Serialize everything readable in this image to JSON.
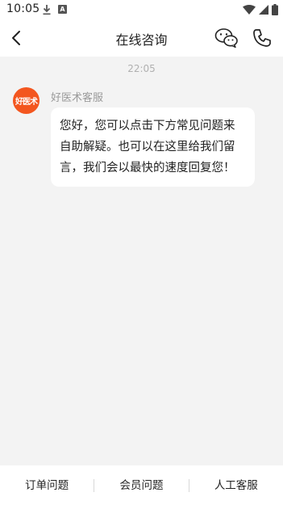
{
  "status_bar": {
    "time": "10:05",
    "a_badge": "A"
  },
  "header": {
    "title": "在线咨询"
  },
  "chat": {
    "timestamp": "22:05",
    "messages": [
      {
        "avatar_text": "好医术",
        "sender": "好医术客服",
        "text": "您好，您可以点击下方常见问题来自助解疑。也可以在这里给我们留言，我们会以最快的速度回复您！"
      }
    ]
  },
  "bottom_bar": {
    "buttons": [
      {
        "label": "订单问题"
      },
      {
        "label": "会员问题"
      },
      {
        "label": "人工客服"
      }
    ]
  },
  "colors": {
    "brand_orange": "#f3561f",
    "page_bg": "#f3f3f3"
  }
}
